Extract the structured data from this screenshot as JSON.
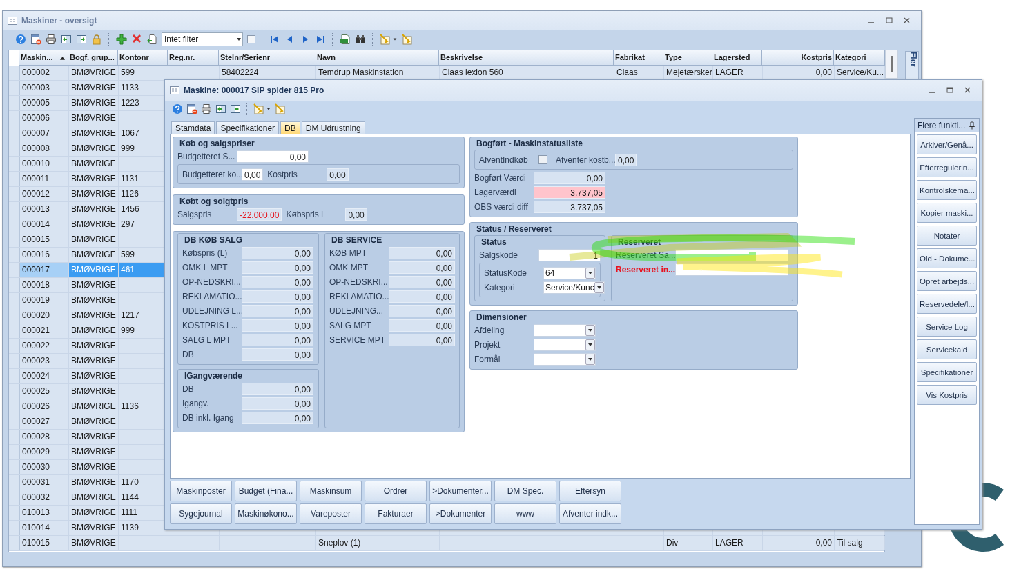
{
  "main_window": {
    "title": "Maskiner - oversigt",
    "filter": {
      "value": "Intet filter",
      "checked": false
    },
    "grid": {
      "columns": [
        {
          "label": "Maskin...",
          "sorted": true
        },
        {
          "label": "Bogf. grup...",
          "sorted": false
        },
        {
          "label": "Kontonr",
          "sorted": false
        },
        {
          "label": "Reg.nr.",
          "sorted": false
        },
        {
          "label": "Stelnr/Serienr",
          "sorted": false
        },
        {
          "label": "Navn",
          "sorted": false
        },
        {
          "label": "Beskrivelse",
          "sorted": false
        },
        {
          "label": "Fabrikat",
          "sorted": false
        },
        {
          "label": "Type",
          "sorted": false
        },
        {
          "label": "Lagersted",
          "sorted": false
        },
        {
          "label": "Kostpris",
          "sorted": false
        },
        {
          "label": "Kategori",
          "sorted": false
        }
      ],
      "rows": [
        {
          "selected": false,
          "maskinnr": "000002",
          "bogf_grup": "BMØVRIGE",
          "kontonr": "599",
          "stelnr": "58402224",
          "navn": "Temdrup Maskinstation",
          "beskrivelse": "Claas lexion 560",
          "fabrikat": "Claas",
          "type": "Mejetærsker",
          "lagersted": "LAGER",
          "kostpris": "0,00",
          "kategori": "Service/Ku..."
        },
        {
          "selected": false,
          "maskinnr": "000003",
          "bogf_grup": "BMØVRIGE",
          "kontonr": "1133"
        },
        {
          "selected": false,
          "maskinnr": "000005",
          "bogf_grup": "BMØVRIGE",
          "kontonr": "1223"
        },
        {
          "selected": false,
          "maskinnr": "000006",
          "bogf_grup": "BMØVRIGE"
        },
        {
          "selected": false,
          "maskinnr": "000007",
          "bogf_grup": "BMØVRIGE",
          "kontonr": "1067"
        },
        {
          "selected": false,
          "maskinnr": "000008",
          "bogf_grup": "BMØVRIGE",
          "kontonr": "999"
        },
        {
          "selected": false,
          "maskinnr": "000010",
          "bogf_grup": "BMØVRIGE"
        },
        {
          "selected": false,
          "maskinnr": "000011",
          "bogf_grup": "BMØVRIGE",
          "kontonr": "1131"
        },
        {
          "selected": false,
          "maskinnr": "000012",
          "bogf_grup": "BMØVRIGE",
          "kontonr": "1126"
        },
        {
          "selected": false,
          "maskinnr": "000013",
          "bogf_grup": "BMØVRIGE",
          "kontonr": "1456"
        },
        {
          "selected": false,
          "maskinnr": "000014",
          "bogf_grup": "BMØVRIGE",
          "kontonr": "297"
        },
        {
          "selected": false,
          "maskinnr": "000015",
          "bogf_grup": "BMØVRIGE"
        },
        {
          "selected": false,
          "maskinnr": "000016",
          "bogf_grup": "BMØVRIGE",
          "kontonr": "599"
        },
        {
          "selected": true,
          "maskinnr": "000017",
          "bogf_grup": "BMØVRIGE",
          "kontonr": "461"
        },
        {
          "selected": false,
          "maskinnr": "000018",
          "bogf_grup": "BMØVRIGE"
        },
        {
          "selected": false,
          "maskinnr": "000019",
          "bogf_grup": "BMØVRIGE"
        },
        {
          "selected": false,
          "maskinnr": "000020",
          "bogf_grup": "BMØVRIGE",
          "kontonr": "1217"
        },
        {
          "selected": false,
          "maskinnr": "000021",
          "bogf_grup": "BMØVRIGE",
          "kontonr": "999"
        },
        {
          "selected": false,
          "maskinnr": "000022",
          "bogf_grup": "BMØVRIGE"
        },
        {
          "selected": false,
          "maskinnr": "000023",
          "bogf_grup": "BMØVRIGE"
        },
        {
          "selected": false,
          "maskinnr": "000024",
          "bogf_grup": "BMØVRIGE"
        },
        {
          "selected": false,
          "maskinnr": "000025",
          "bogf_grup": "BMØVRIGE"
        },
        {
          "selected": false,
          "maskinnr": "000026",
          "bogf_grup": "BMØVRIGE",
          "kontonr": "1136"
        },
        {
          "selected": false,
          "maskinnr": "000027",
          "bogf_grup": "BMØVRIGE"
        },
        {
          "selected": false,
          "maskinnr": "000028",
          "bogf_grup": "BMØVRIGE"
        },
        {
          "selected": false,
          "maskinnr": "000029",
          "bogf_grup": "BMØVRIGE"
        },
        {
          "selected": false,
          "maskinnr": "000030",
          "bogf_grup": "BMØVRIGE"
        },
        {
          "selected": false,
          "maskinnr": "000031",
          "bogf_grup": "BMØVRIGE",
          "kontonr": "1170"
        },
        {
          "selected": false,
          "maskinnr": "000032",
          "bogf_grup": "BMØVRIGE",
          "kontonr": "1144"
        },
        {
          "selected": false,
          "maskinnr": "010013",
          "bogf_grup": "BMØVRIGE",
          "kontonr": "1111"
        },
        {
          "selected": false,
          "maskinnr": "010014",
          "bogf_grup": "BMØVRIGE",
          "kontonr": "1139"
        },
        {
          "selected": false,
          "maskinnr": "010015",
          "bogf_grup": "BMØVRIGE",
          "navn": "Sneplov (1)",
          "type": "Div",
          "lagersted": "LAGER",
          "kostpris": "0,00",
          "kategori": "Til salg"
        }
      ]
    },
    "side_tab": "Fler"
  },
  "dialog": {
    "title": "Maskine: 000017 SIP spider 815 Pro",
    "tabs": [
      {
        "label": "Stamdata",
        "selected": false
      },
      {
        "label": "Specifikationer",
        "selected": false
      },
      {
        "label": "DB",
        "selected": true
      },
      {
        "label": "DM Udrustning",
        "selected": false
      }
    ],
    "left_groups": [
      {
        "kind": "group",
        "title": "Køb og salgspriser",
        "items": [
          {
            "kind": "field",
            "label": "Budgetteret S...",
            "value": "0,00",
            "editable": true
          },
          {
            "kind": "frame_row",
            "items": [
              {
                "kind": "field",
                "label": "Budgetteret ko...",
                "value": "0,00",
                "editable": true
              },
              {
                "kind": "field",
                "label": "Kostpris",
                "value": "0,00",
                "editable": false
              }
            ]
          }
        ]
      },
      {
        "kind": "group",
        "title": "Købt og solgtpris",
        "items": [
          {
            "kind": "line",
            "items": [
              {
                "kind": "field",
                "label": "Salgspris",
                "value": "-22.000,00",
                "editable": false,
                "negative": true
              },
              {
                "kind": "field",
                "label": "Købspris L",
                "value": "0,00",
                "editable": false
              }
            ]
          }
        ]
      },
      {
        "kind": "group",
        "items": [
          {
            "kind": "columns",
            "items": [
              {
                "kind": "stack",
                "items": [
                  {
                    "kind": "group",
                    "title": "DB KØB SALG",
                    "items": [
                      {
                        "kind": "field",
                        "label": "Købspris (L)",
                        "value": "0,00",
                        "editable": false
                      },
                      {
                        "kind": "field",
                        "label": "OMK L MPT",
                        "value": "0,00",
                        "editable": false
                      },
                      {
                        "kind": "field",
                        "label": "OP-NEDSKRI...",
                        "value": "0,00",
                        "editable": false
                      },
                      {
                        "kind": "field",
                        "label": "REKLAMATIO...",
                        "value": "0,00",
                        "editable": false
                      },
                      {
                        "kind": "field",
                        "label": "UDLEJNING L...",
                        "value": "0,00",
                        "editable": false
                      },
                      {
                        "kind": "field",
                        "label": "KOSTPRIS L...",
                        "value": "0,00",
                        "editable": false
                      },
                      {
                        "kind": "field",
                        "label": "SALG L MPT",
                        "value": "0,00",
                        "editable": false
                      },
                      {
                        "kind": "field",
                        "label": "DB",
                        "value": "0,00",
                        "editable": false
                      }
                    ]
                  },
                  {
                    "kind": "group",
                    "title": "IGangværende",
                    "items": [
                      {
                        "kind": "field",
                        "label": "DB",
                        "value": "0,00",
                        "editable": false
                      },
                      {
                        "kind": "field",
                        "label": "Igangv.",
                        "value": "0,00",
                        "editable": false
                      },
                      {
                        "kind": "field",
                        "label": "DB inkl. Igang",
                        "value": "0,00",
                        "editable": false
                      }
                    ]
                  }
                ]
              },
              {
                "kind": "group",
                "title": "DB SERVICE",
                "items": [
                  {
                    "kind": "field",
                    "label": "KØB MPT",
                    "value": "0,00",
                    "editable": false
                  },
                  {
                    "kind": "field",
                    "label": "OMK MPT",
                    "value": "0,00",
                    "editable": false
                  },
                  {
                    "kind": "field",
                    "label": "OP-NEDSKRI...",
                    "value": "0,00",
                    "editable": false
                  },
                  {
                    "kind": "field",
                    "label": "REKLAMATIO...",
                    "value": "0,00",
                    "editable": false
                  },
                  {
                    "kind": "field",
                    "label": "UDLEJNING...",
                    "value": "0,00",
                    "editable": false
                  },
                  {
                    "kind": "field",
                    "label": "SALG MPT",
                    "value": "0,00",
                    "editable": false
                  },
                  {
                    "kind": "field",
                    "label": "SERVICE MPT",
                    "value": "0,00",
                    "editable": false
                  }
                ]
              }
            ]
          }
        ]
      }
    ],
    "right_groups": [
      {
        "kind": "group",
        "title": "Bogført - Maskinstatusliste",
        "items": [
          {
            "kind": "frame_row",
            "items": [
              {
                "kind": "checkbox",
                "label": "AfventIndkøb",
                "checked": false
              },
              {
                "kind": "field",
                "label": "Afventer kostb...",
                "value": "0,00",
                "editable": false
              }
            ]
          },
          {
            "kind": "field",
            "label": "Bogført Værdi",
            "value": "0,00",
            "editable": false
          },
          {
            "kind": "field",
            "label": "Lagerværdi",
            "value": "3.737,05",
            "editable": false,
            "warning": true
          },
          {
            "kind": "field",
            "label": "OBS værdi diff",
            "value": "3.737,05",
            "editable": false
          }
        ]
      },
      {
        "kind": "group",
        "title": "Status / Reserveret",
        "items": [
          {
            "kind": "columns",
            "items": [
              {
                "kind": "group",
                "title": "Status",
                "items": [
                  {
                    "kind": "field",
                    "label": "Salgskode",
                    "value": "1",
                    "editable": true
                  },
                  {
                    "kind": "frame_column",
                    "items": [
                      {
                        "kind": "combo",
                        "label": "StatusKode",
                        "value": "64"
                      },
                      {
                        "kind": "combo",
                        "label": "Kategori",
                        "value": "Service/Kunc"
                      }
                    ]
                  }
                ]
              },
              {
                "kind": "group",
                "title": "Reserveret",
                "items": [
                  {
                    "kind": "field",
                    "label": "Reserveret Sa...",
                    "editable": true
                  },
                  {
                    "kind": "field",
                    "label": "Reserveret in...",
                    "editable": true,
                    "label_alert": true
                  }
                ]
              }
            ]
          }
        ]
      },
      {
        "kind": "group",
        "title": "Dimensioner",
        "items": [
          {
            "kind": "combo",
            "label": "Afdeling"
          },
          {
            "kind": "combo",
            "label": "Projekt"
          },
          {
            "kind": "combo",
            "label": "Formål"
          }
        ]
      }
    ],
    "buttons": [
      "Maskinposter",
      "Budget (Fina...",
      "Maskinsum",
      "Ordrer",
      ">Dokumenter...",
      "DM Spec.",
      "Eftersyn",
      "Sygejournal",
      "Maskinøkono...",
      "Vareposter",
      "Fakturaer",
      ">Dokumenter",
      "www",
      "Afventer indk..."
    ],
    "side_panel": {
      "title": "Flere funkti...",
      "buttons": [
        "Arkiver/Genå...",
        "Efterregulerin...",
        "Kontrolskema...",
        "Kopier maski...",
        "Notater",
        "Old - Dokume...",
        "Opret arbejds...",
        "Reservedele/l...",
        "Service Log",
        "Servicekald",
        "Specifikationer",
        "Vis Kostpris"
      ]
    }
  }
}
